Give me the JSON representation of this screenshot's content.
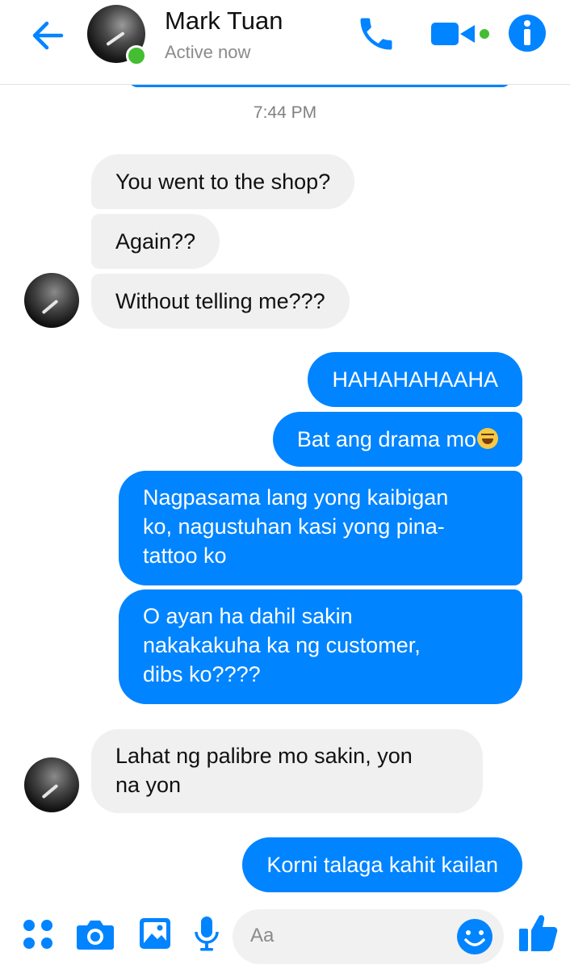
{
  "header": {
    "contact_name": "Mark Tuan",
    "status": "Active now",
    "accent_color": "#0084ff",
    "online_color": "#44bd32",
    "icons": [
      "back-arrow-icon",
      "phone-icon",
      "video-camera-icon",
      "info-icon"
    ]
  },
  "timestamp": "7:44 PM",
  "messages": [
    {
      "sender": "contact",
      "text": "You went to the shop?"
    },
    {
      "sender": "contact",
      "text": "Again??"
    },
    {
      "sender": "contact",
      "text": "Without telling me???"
    },
    {
      "sender": "me",
      "text": "HAHAHAHAAHA"
    },
    {
      "sender": "me",
      "text": "Bat ang drama mo",
      "emoji": "face-with-tears-of-joy"
    },
    {
      "sender": "me",
      "text": "Nagpasama lang yong kaibigan\nko, nagustuhan kasi yong pina-\ntattoo ko"
    },
    {
      "sender": "me",
      "text": "O ayan ha dahil sakin\nnakakakuha ka ng customer,\ndibs ko????"
    },
    {
      "sender": "contact",
      "text": "Lahat ng palibre mo sakin, yon\nna yon"
    },
    {
      "sender": "me",
      "text": "Korni talaga kahit kailan"
    }
  ],
  "composer": {
    "placeholder": "Aa",
    "icons": [
      "apps-grid-icon",
      "camera-icon",
      "gallery-icon",
      "microphone-icon",
      "emoji-icon",
      "thumbs-up-icon"
    ]
  }
}
